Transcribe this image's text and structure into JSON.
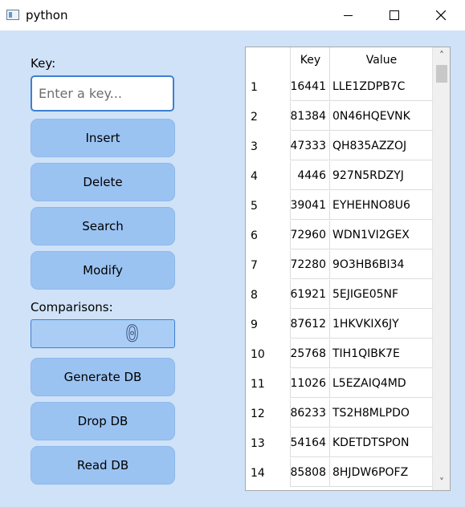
{
  "window": {
    "title": "python",
    "app_icon": "python-window-icon",
    "minimize_icon": "minimize-icon",
    "maximize_icon": "maximize-icon",
    "close_icon": "close-icon"
  },
  "form": {
    "key_label": "Key:",
    "key_placeholder": "Enter a key...",
    "key_value": "",
    "insert_label": "Insert",
    "delete_label": "Delete",
    "search_label": "Search",
    "modify_label": "Modify",
    "comparisons_label": "Comparisons:",
    "comparisons_value": "0",
    "generate_label": "Generate DB",
    "drop_label": "Drop DB",
    "read_label": "Read DB"
  },
  "table": {
    "headers": [
      "Key",
      "Value"
    ],
    "rows": [
      {
        "num": "1",
        "key": "16441",
        "value": "LLE1ZDPB7C"
      },
      {
        "num": "2",
        "key": "81384",
        "value": "0N46HQEVNK"
      },
      {
        "num": "3",
        "key": "47333",
        "value": "QH835AZZOJ"
      },
      {
        "num": "4",
        "key": "4446",
        "value": "927N5RDZYJ"
      },
      {
        "num": "5",
        "key": "39041",
        "value": "EYHEHNO8U6"
      },
      {
        "num": "6",
        "key": "72960",
        "value": "WDN1VI2GEX"
      },
      {
        "num": "7",
        "key": "72280",
        "value": "9O3HB6BI34"
      },
      {
        "num": "8",
        "key": "61921",
        "value": "5EJIGE05NF"
      },
      {
        "num": "9",
        "key": "87612",
        "value": "1HKVKIX6JY"
      },
      {
        "num": "10",
        "key": "25768",
        "value": "TIH1QIBK7E"
      },
      {
        "num": "11",
        "key": "11026",
        "value": "L5EZAIQ4MD"
      },
      {
        "num": "12",
        "key": "86233",
        "value": "TS2H8MLPDO"
      },
      {
        "num": "13",
        "key": "54164",
        "value": "KDETDTSPON"
      },
      {
        "num": "14",
        "key": "85808",
        "value": "8HJDW6POFZ"
      }
    ],
    "scroll_up_icon": "scroll-up-arrow-icon",
    "scroll_down_icon": "scroll-down-arrow-icon"
  },
  "colors": {
    "background": "#cfe2f7",
    "button": "#9bc3f2",
    "focus_border": "#3d7fd4"
  }
}
